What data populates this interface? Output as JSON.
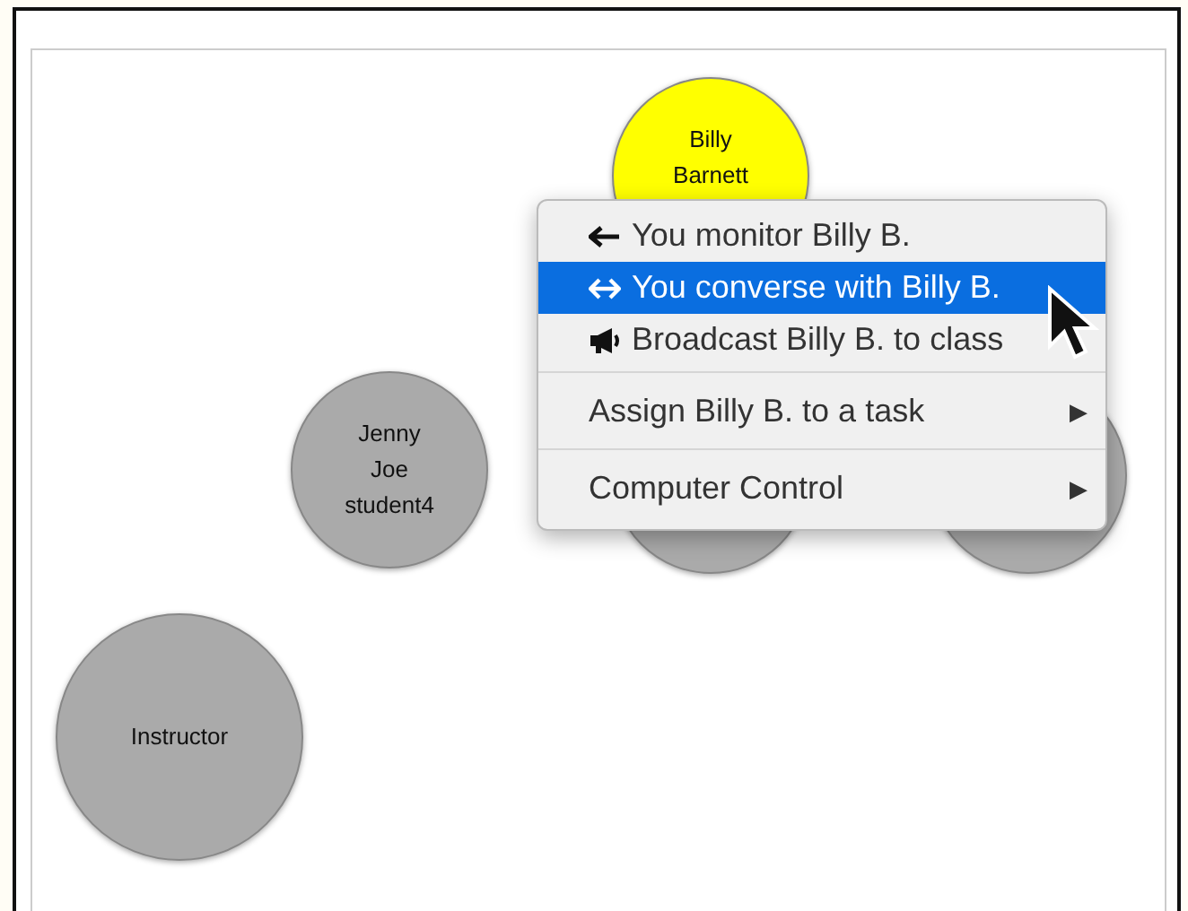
{
  "nodes": [
    {
      "lines": [
        "Billy",
        "Barnett"
      ],
      "color": "#ffff00"
    },
    {
      "lines": [
        "Jenny",
        "Joe",
        "student4"
      ],
      "color": "#aaaaaa"
    },
    {
      "color": "#aaaaaa"
    },
    {
      "color": "#aaaaaa"
    },
    {
      "lines": [
        "Instructor"
      ],
      "color": "#aaaaaa"
    }
  ],
  "menu": {
    "items": [
      {
        "kind": "monitor",
        "label": "You monitor Billy B.",
        "selected": false
      },
      {
        "kind": "converse",
        "label": "You converse with Billy B.",
        "selected": true
      },
      {
        "kind": "broadcast",
        "label": "Broadcast Billy B. to class",
        "selected": false
      },
      {
        "kind": "submenu",
        "label": "Assign Billy B. to a task",
        "arrow": "▶",
        "selected": false
      },
      {
        "kind": "submenu",
        "label": "Computer Control",
        "arrow": "▶",
        "selected": false
      }
    ]
  }
}
